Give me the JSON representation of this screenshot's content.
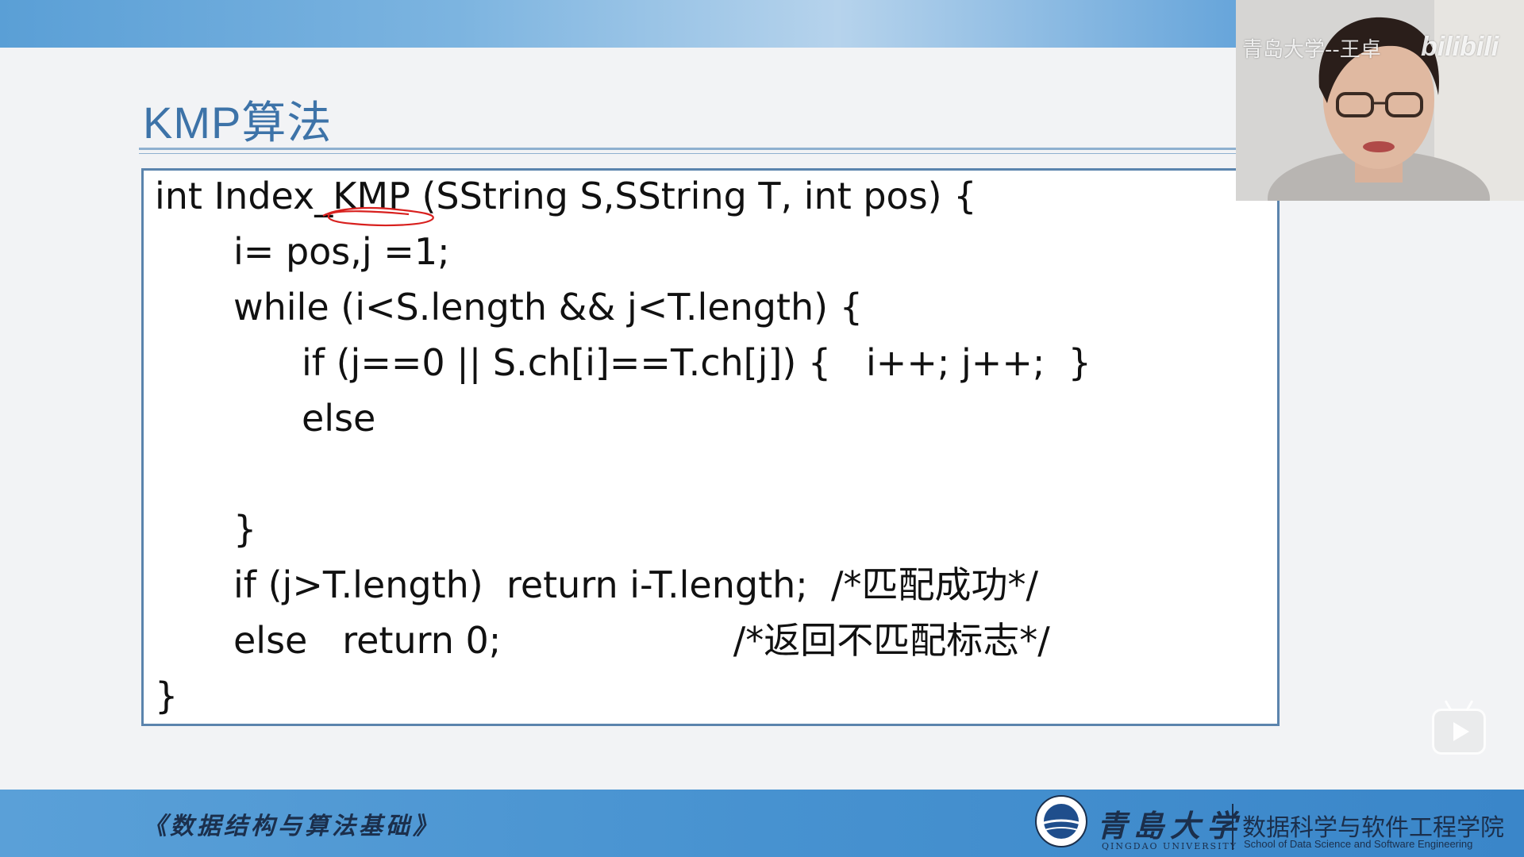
{
  "slide": {
    "title": "KMP算法",
    "code_lines": [
      "int Index_KMP (SString S,SString T, int pos) {",
      "i= pos,j =1;",
      "while (i<S.length && j<T.length) {",
      "if (j==0 || S.ch[i]==T.ch[j]) {   i++; j++;  }",
      "else",
      "}",
      "if (j>T.length)  return i-T.length;  /*匹配成功*/",
      "else   return 0;                    /*返回不匹配标志*/",
      "}"
    ]
  },
  "footer": {
    "course": "《数据结构与算法基础》",
    "university_cn": "青島大学",
    "university_en": "QINGDAO UNIVERSITY",
    "school_cn": "数据科学与软件工程学院",
    "school_en": "School of Data Science and Software Engineering"
  },
  "webcam": {
    "watermark": "青岛大学--王卓",
    "platform_logo": "bilibili"
  },
  "colors": {
    "title": "#3d73a8",
    "band": "#4792d0",
    "code_border": "#5b84ad",
    "annotation": "#d8201e"
  }
}
